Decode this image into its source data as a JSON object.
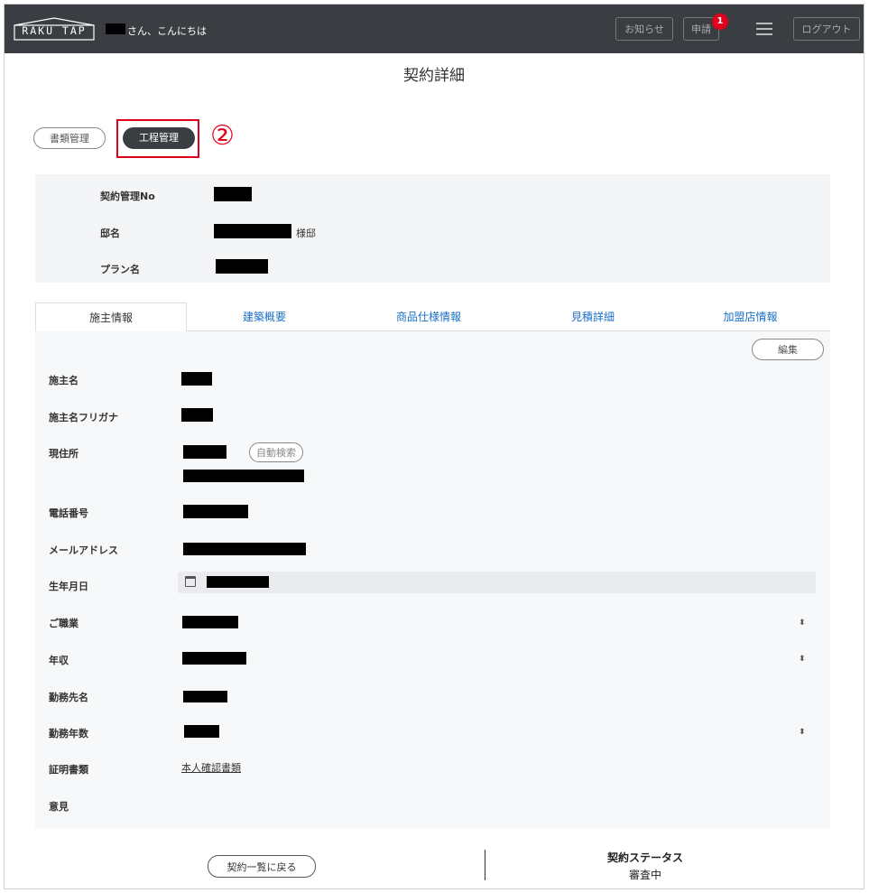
{
  "header": {
    "logo_text": "RAKU TAP",
    "greeting": "さん、こんにちは",
    "notice_label": "お知らせ",
    "request_label": "申請",
    "request_badge": "1",
    "logout_label": "ログアウト"
  },
  "page": {
    "title": "契約詳細",
    "docs_button": "書類管理",
    "process_button": "工程管理",
    "annotation": "②"
  },
  "summary": {
    "contract_no_label": "契約管理No",
    "residence_label": "邸名",
    "residence_suffix": "様邸",
    "plan_label": "プラン名"
  },
  "tabs": [
    {
      "label": "施主情報",
      "active": true
    },
    {
      "label": "建築概要",
      "active": false
    },
    {
      "label": "商品仕様情報",
      "active": false
    },
    {
      "label": "見積詳細",
      "active": false
    },
    {
      "label": "加盟店情報",
      "active": false
    }
  ],
  "owner": {
    "edit_button": "編集",
    "fields": {
      "name": "施主名",
      "kana": "施主名フリガナ",
      "address": "現住所",
      "phone": "電話番号",
      "email": "メールアドレス",
      "birthdate": "生年月日",
      "occupation": "ご職業",
      "income": "年収",
      "employer": "勤務先名",
      "years": "勤務年数",
      "documents": "証明書類",
      "opinion": "意見"
    },
    "auto_search_button": "自動検索",
    "documents_link": "本人確認書類",
    "select_arrow": "⬍"
  },
  "footer": {
    "back_button": "契約一覧に戻る",
    "status_label": "契約ステータス",
    "status_value": "審査中"
  }
}
